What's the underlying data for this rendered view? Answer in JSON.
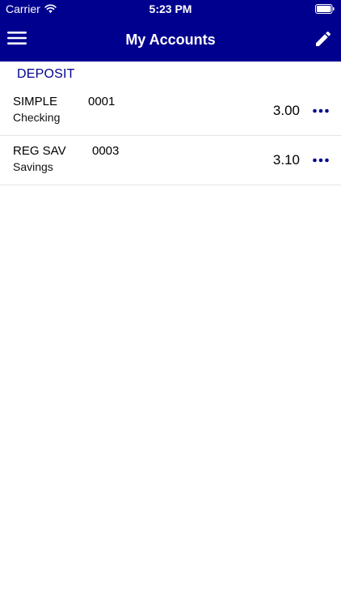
{
  "status_bar": {
    "carrier": "Carrier",
    "time": "5:23 PM"
  },
  "nav": {
    "title": "My Accounts",
    "left_icon": "menu-icon",
    "right_icon": "pencil-icon"
  },
  "colors": {
    "brand": "#00008f",
    "header_text": "#ffffff",
    "divider": "#e4e4e4"
  },
  "sections": [
    {
      "title": "DEPOSIT",
      "accounts": [
        {
          "name": "SIMPLE",
          "number": "0001",
          "type": "Checking",
          "balance": "3.00"
        },
        {
          "name": "REG SAV",
          "number": "0003",
          "type": "Savings",
          "balance": "3.10"
        }
      ]
    }
  ]
}
